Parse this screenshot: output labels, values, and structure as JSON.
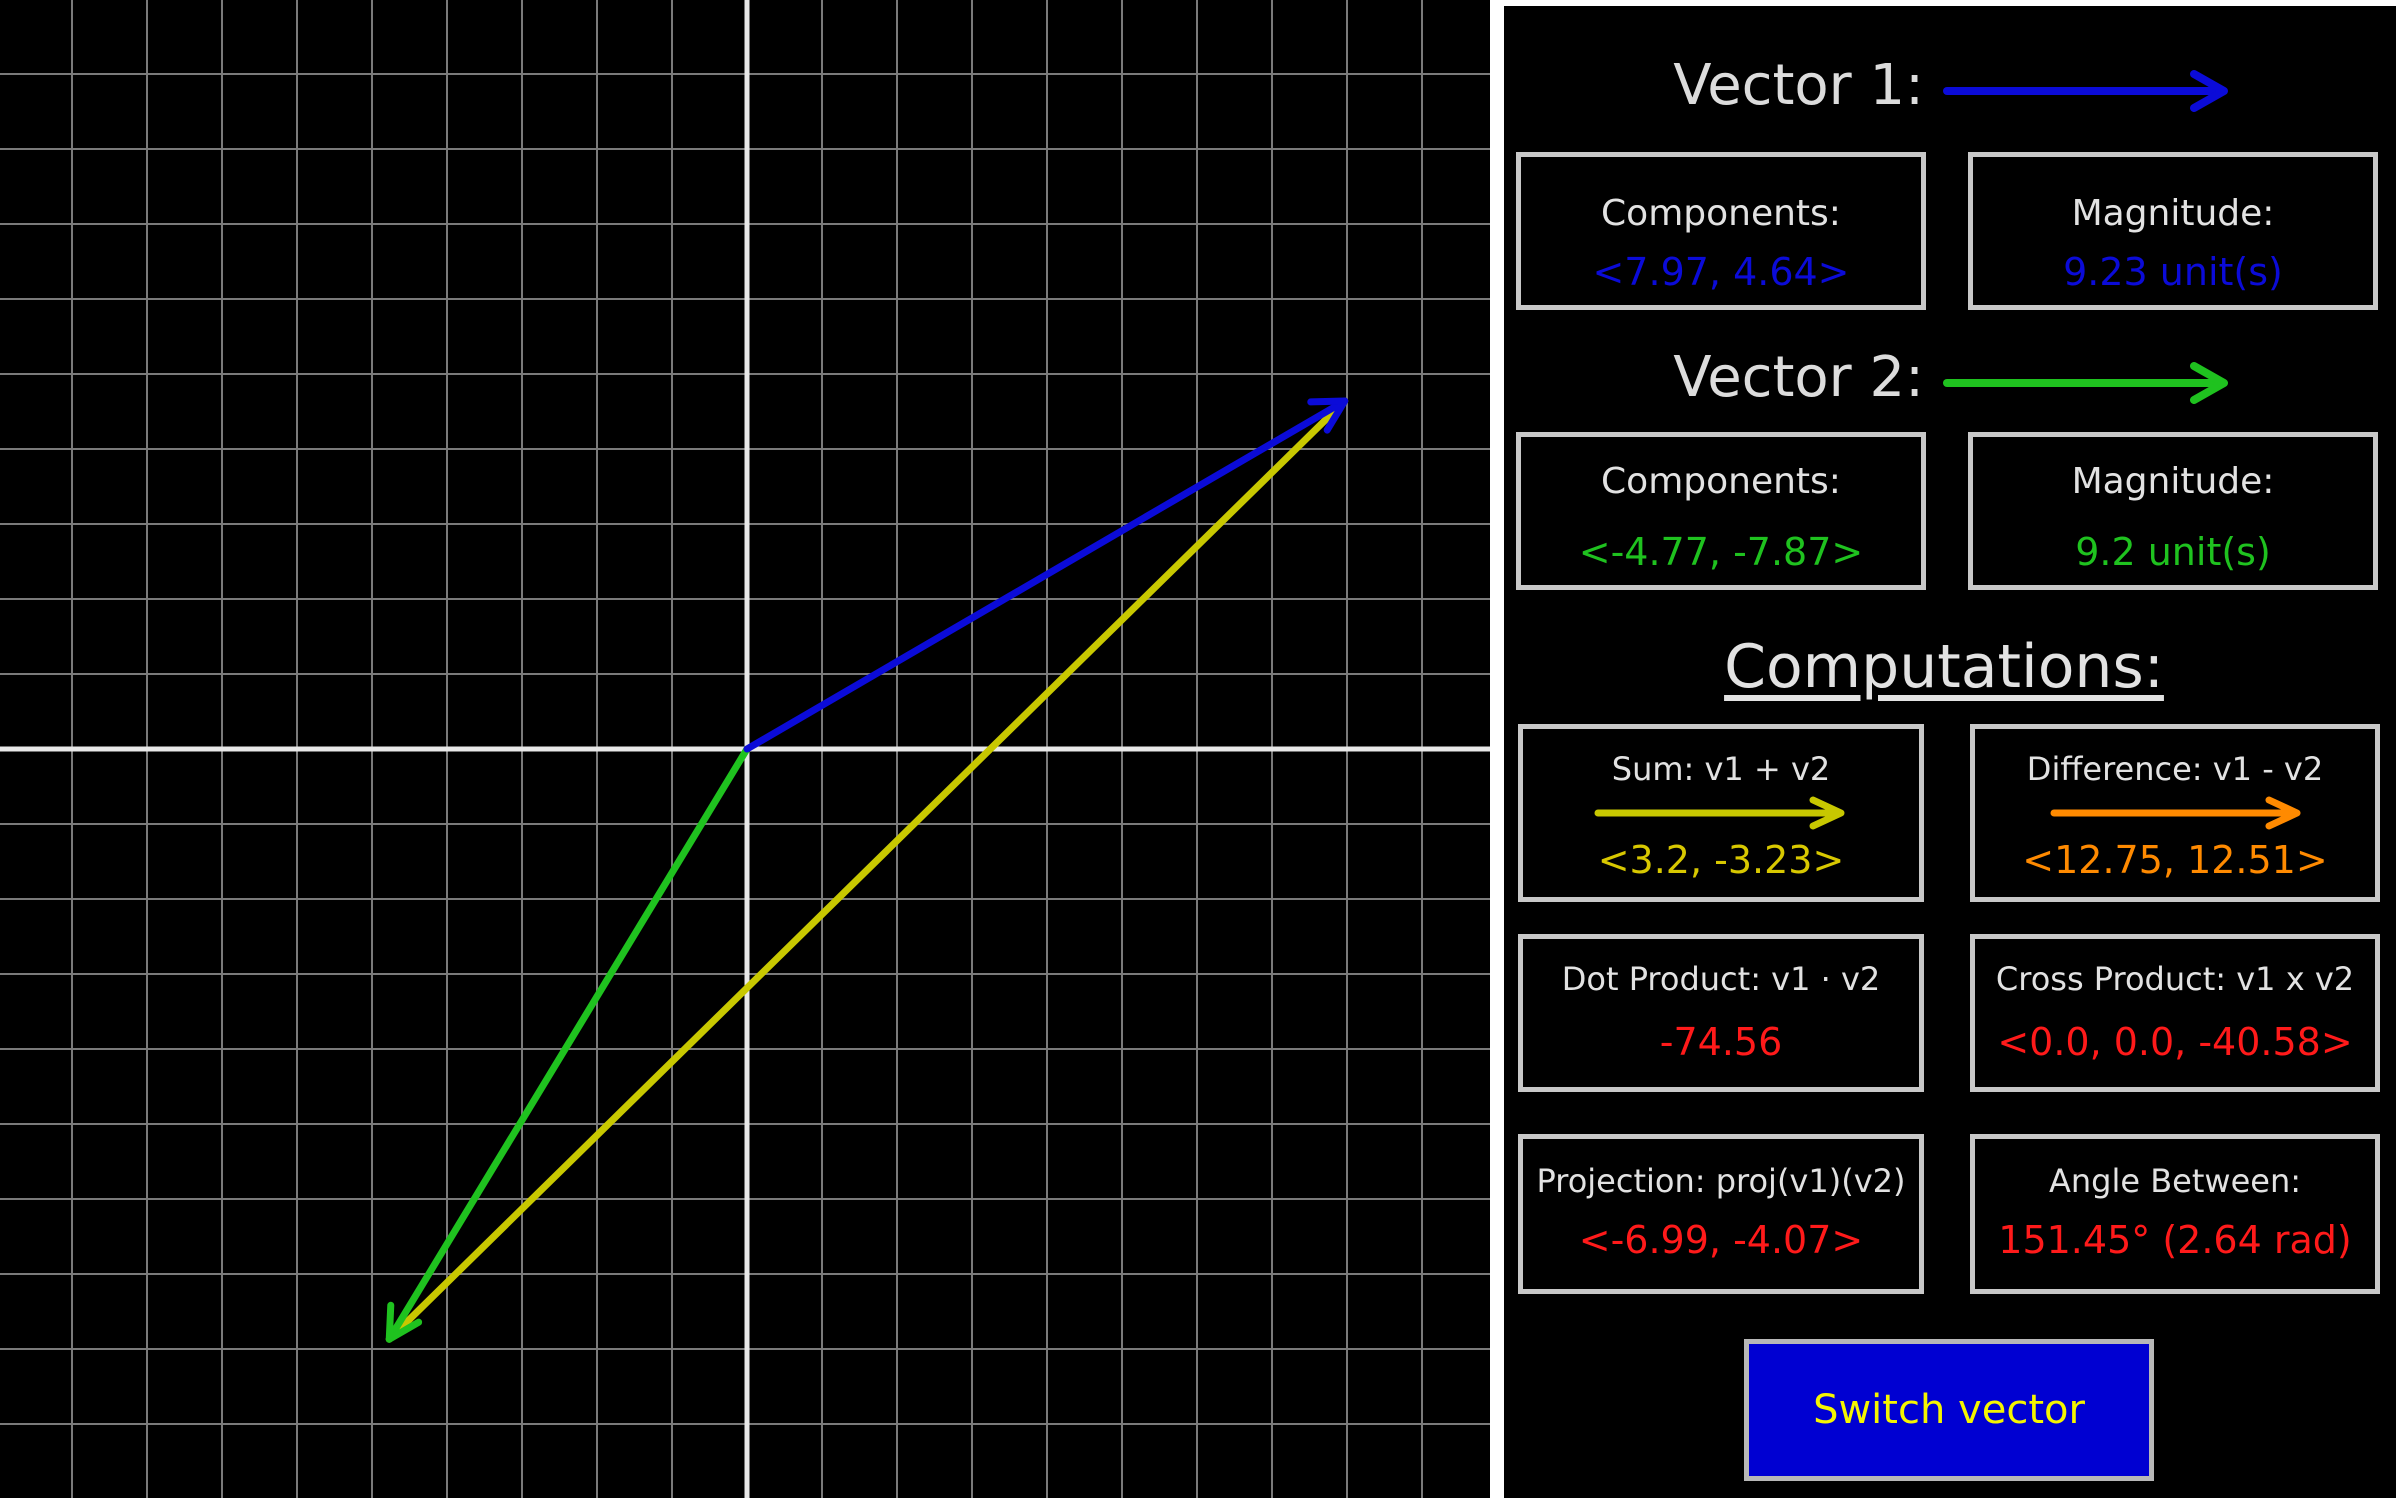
{
  "plane": {
    "colors": {
      "background": "#000000",
      "grid": "#7a7a7a",
      "axes": "#e8e8e8"
    },
    "vectors": [
      {
        "id": "v1",
        "components": [
          7.97,
          4.64
        ],
        "color": "#0b0bd8"
      },
      {
        "id": "v2",
        "components": [
          -4.77,
          -7.87
        ],
        "color": "#1fc21f"
      },
      {
        "id": "sum",
        "color": "#c8c800"
      }
    ]
  },
  "vector1": {
    "title": "Vector 1:",
    "color": "#0b0bd8",
    "components_label": "Components:",
    "components_value": "<7.97, 4.64>",
    "magnitude_label": "Magnitude:",
    "magnitude_value": "9.23 unit(s)"
  },
  "vector2": {
    "title": "Vector 2:",
    "color": "#1fc21f",
    "components_label": "Components:",
    "components_value": "<-4.77, -7.87>",
    "magnitude_label": "Magnitude:",
    "magnitude_value": "9.2 unit(s)"
  },
  "computations": {
    "title": "Computations:",
    "sum": {
      "label": "Sum: v1 + v2",
      "value": "<3.2, -3.23>",
      "color": "#c8c800"
    },
    "difference": {
      "label": "Difference: v1 - v2",
      "value": "<12.75, 12.51>",
      "color": "#ff8a00"
    },
    "dot": {
      "label": "Dot Product: v1 · v2",
      "value": "-74.56",
      "color": "#ff1a1a"
    },
    "cross": {
      "label": "Cross Product: v1 x v2",
      "value": "<0.0, 0.0, -40.58>",
      "color": "#ff1a1a"
    },
    "projection": {
      "label": "Projection: proj(v1)(v2)",
      "value": "<-6.99, -4.07>",
      "color": "#ff1a1a"
    },
    "angle": {
      "label": "Angle Between:",
      "value": "151.45° (2.64 rad)",
      "color": "#ff1a1a"
    }
  },
  "switch_button": {
    "label": "Switch vector"
  }
}
